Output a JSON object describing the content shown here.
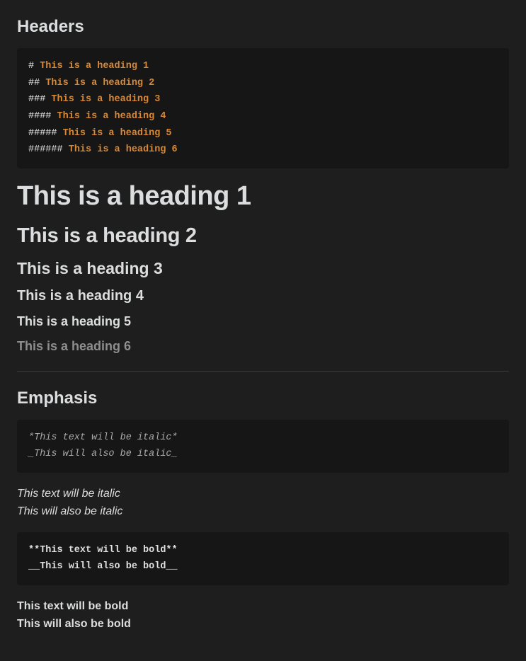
{
  "headers_section": {
    "title": "Headers",
    "code_lines": [
      {
        "hash": "# ",
        "text": "This is a heading 1"
      },
      {
        "hash": "## ",
        "text": "This is a heading 2"
      },
      {
        "hash": "### ",
        "text": "This is a heading 3"
      },
      {
        "hash": "#### ",
        "text": "This is a heading 4"
      },
      {
        "hash": "##### ",
        "text": "This is a heading 5"
      },
      {
        "hash": "###### ",
        "text": "This is a heading 6"
      }
    ],
    "rendered": {
      "h1": "This is a heading 1",
      "h2": "This is a heading 2",
      "h3": "This is a heading 3",
      "h4": "This is a heading 4",
      "h5": "This is a heading 5",
      "h6": "This is a heading 6"
    }
  },
  "emphasis_section": {
    "title": "Emphasis",
    "italic_code": {
      "line1": "*This text will be italic*",
      "line2": "_This will also be italic_"
    },
    "italic_rendered": {
      "line1": "This text will be italic",
      "line2": "This will also be italic"
    },
    "bold_code": {
      "line1": "**This text will be bold**",
      "line2": "__This will also be bold__"
    },
    "bold_rendered": {
      "line1": "This text will be bold",
      "line2": "This will also be bold"
    }
  }
}
